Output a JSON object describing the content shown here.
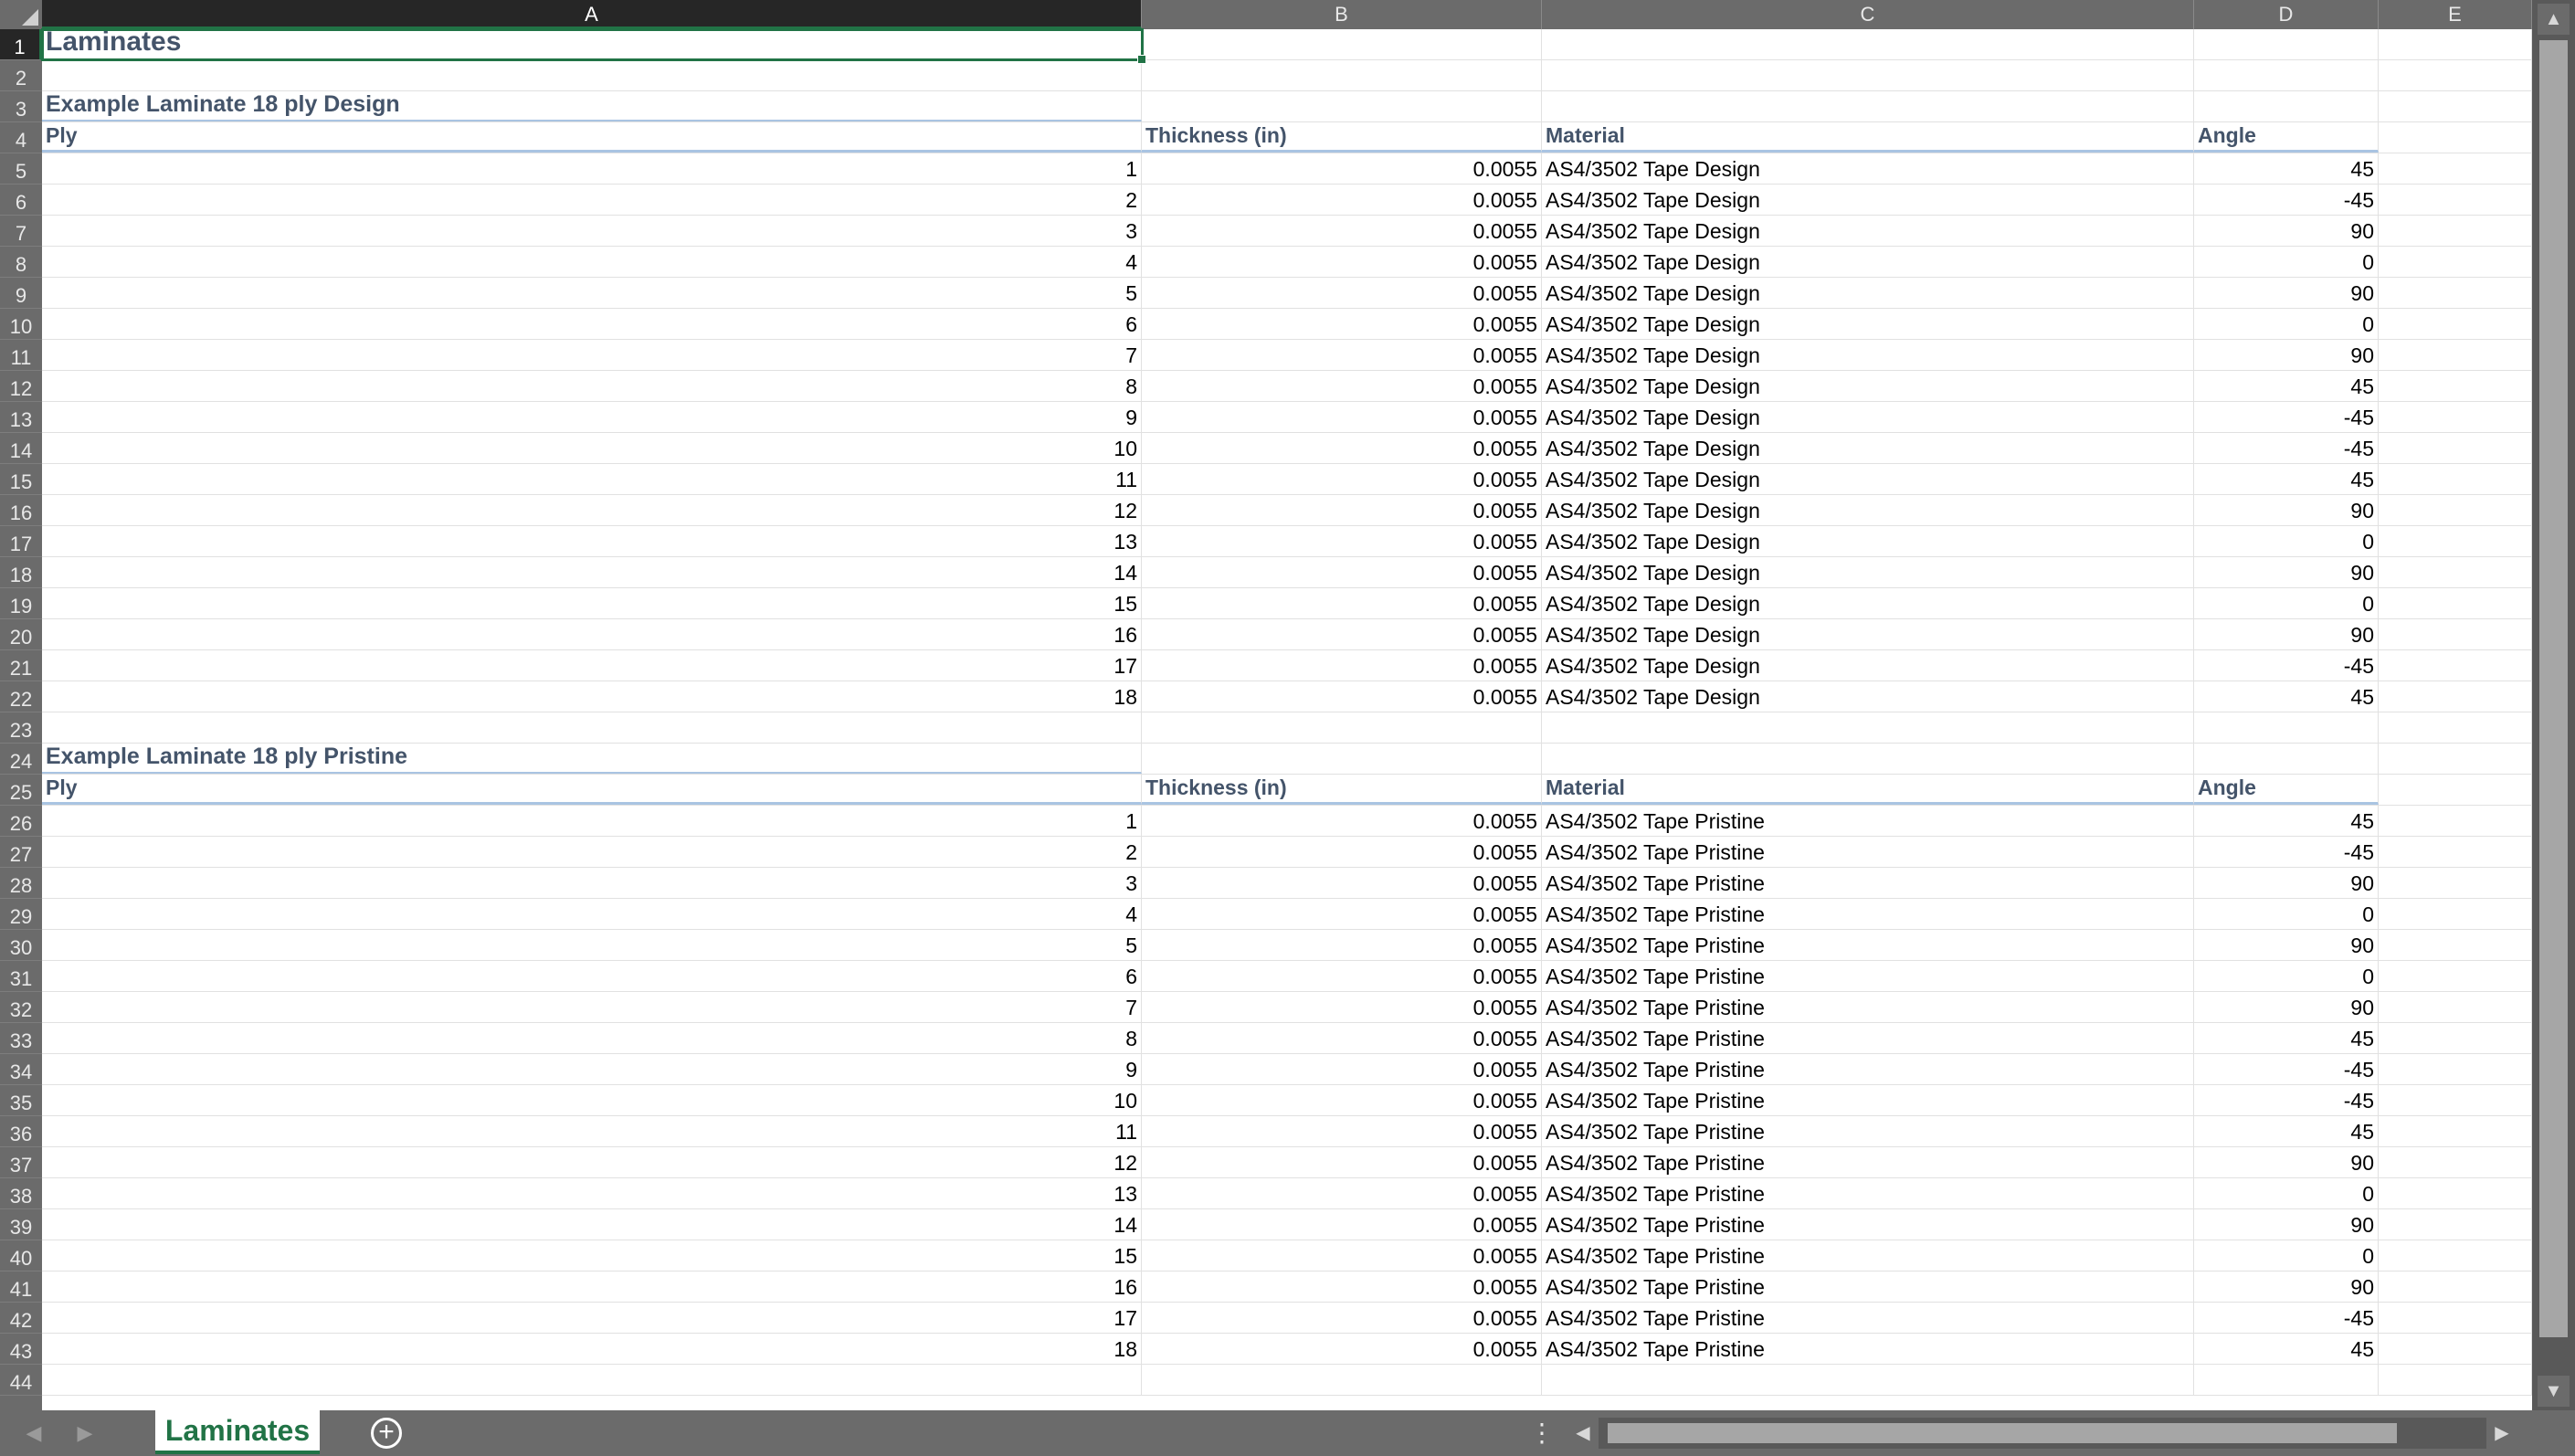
{
  "columns": [
    "A",
    "B",
    "C",
    "D",
    "E"
  ],
  "selected_cell": "A1",
  "title": "Laminates",
  "tables": [
    {
      "name": "Example Laminate 18 ply Design",
      "headers": [
        "Ply",
        "Thickness (in)",
        "Material",
        "Angle"
      ],
      "rows": [
        [
          "1",
          "0.0055",
          "AS4/3502 Tape Design",
          "45"
        ],
        [
          "2",
          "0.0055",
          "AS4/3502 Tape Design",
          "-45"
        ],
        [
          "3",
          "0.0055",
          "AS4/3502 Tape Design",
          "90"
        ],
        [
          "4",
          "0.0055",
          "AS4/3502 Tape Design",
          "0"
        ],
        [
          "5",
          "0.0055",
          "AS4/3502 Tape Design",
          "90"
        ],
        [
          "6",
          "0.0055",
          "AS4/3502 Tape Design",
          "0"
        ],
        [
          "7",
          "0.0055",
          "AS4/3502 Tape Design",
          "90"
        ],
        [
          "8",
          "0.0055",
          "AS4/3502 Tape Design",
          "45"
        ],
        [
          "9",
          "0.0055",
          "AS4/3502 Tape Design",
          "-45"
        ],
        [
          "10",
          "0.0055",
          "AS4/3502 Tape Design",
          "-45"
        ],
        [
          "11",
          "0.0055",
          "AS4/3502 Tape Design",
          "45"
        ],
        [
          "12",
          "0.0055",
          "AS4/3502 Tape Design",
          "90"
        ],
        [
          "13",
          "0.0055",
          "AS4/3502 Tape Design",
          "0"
        ],
        [
          "14",
          "0.0055",
          "AS4/3502 Tape Design",
          "90"
        ],
        [
          "15",
          "0.0055",
          "AS4/3502 Tape Design",
          "0"
        ],
        [
          "16",
          "0.0055",
          "AS4/3502 Tape Design",
          "90"
        ],
        [
          "17",
          "0.0055",
          "AS4/3502 Tape Design",
          "-45"
        ],
        [
          "18",
          "0.0055",
          "AS4/3502 Tape Design",
          "45"
        ]
      ]
    },
    {
      "name": "Example Laminate 18 ply Pristine",
      "headers": [
        "Ply",
        "Thickness (in)",
        "Material",
        "Angle"
      ],
      "rows": [
        [
          "1",
          "0.0055",
          "AS4/3502 Tape Pristine",
          "45"
        ],
        [
          "2",
          "0.0055",
          "AS4/3502 Tape Pristine",
          "-45"
        ],
        [
          "3",
          "0.0055",
          "AS4/3502 Tape Pristine",
          "90"
        ],
        [
          "4",
          "0.0055",
          "AS4/3502 Tape Pristine",
          "0"
        ],
        [
          "5",
          "0.0055",
          "AS4/3502 Tape Pristine",
          "90"
        ],
        [
          "6",
          "0.0055",
          "AS4/3502 Tape Pristine",
          "0"
        ],
        [
          "7",
          "0.0055",
          "AS4/3502 Tape Pristine",
          "90"
        ],
        [
          "8",
          "0.0055",
          "AS4/3502 Tape Pristine",
          "45"
        ],
        [
          "9",
          "0.0055",
          "AS4/3502 Tape Pristine",
          "-45"
        ],
        [
          "10",
          "0.0055",
          "AS4/3502 Tape Pristine",
          "-45"
        ],
        [
          "11",
          "0.0055",
          "AS4/3502 Tape Pristine",
          "45"
        ],
        [
          "12",
          "0.0055",
          "AS4/3502 Tape Pristine",
          "90"
        ],
        [
          "13",
          "0.0055",
          "AS4/3502 Tape Pristine",
          "0"
        ],
        [
          "14",
          "0.0055",
          "AS4/3502 Tape Pristine",
          "90"
        ],
        [
          "15",
          "0.0055",
          "AS4/3502 Tape Pristine",
          "0"
        ],
        [
          "16",
          "0.0055",
          "AS4/3502 Tape Pristine",
          "90"
        ],
        [
          "17",
          "0.0055",
          "AS4/3502 Tape Pristine",
          "-45"
        ],
        [
          "18",
          "0.0055",
          "AS4/3502 Tape Pristine",
          "45"
        ]
      ]
    }
  ],
  "sheet_tabs": [
    "Laminates"
  ],
  "icons": {
    "select_all": "select-all-corner-icon",
    "add_sheet": "plus-circle-icon",
    "more": "vertical-ellipsis-icon",
    "scroll_up": "triangle-up-icon",
    "scroll_down": "triangle-down-icon",
    "scroll_left": "triangle-left-icon",
    "scroll_right": "triangle-right-icon"
  },
  "colors": {
    "accent": "#217346",
    "header_text": "#44546a",
    "header_underline": "#a9c4e2",
    "chrome": "#6b6b6b"
  }
}
